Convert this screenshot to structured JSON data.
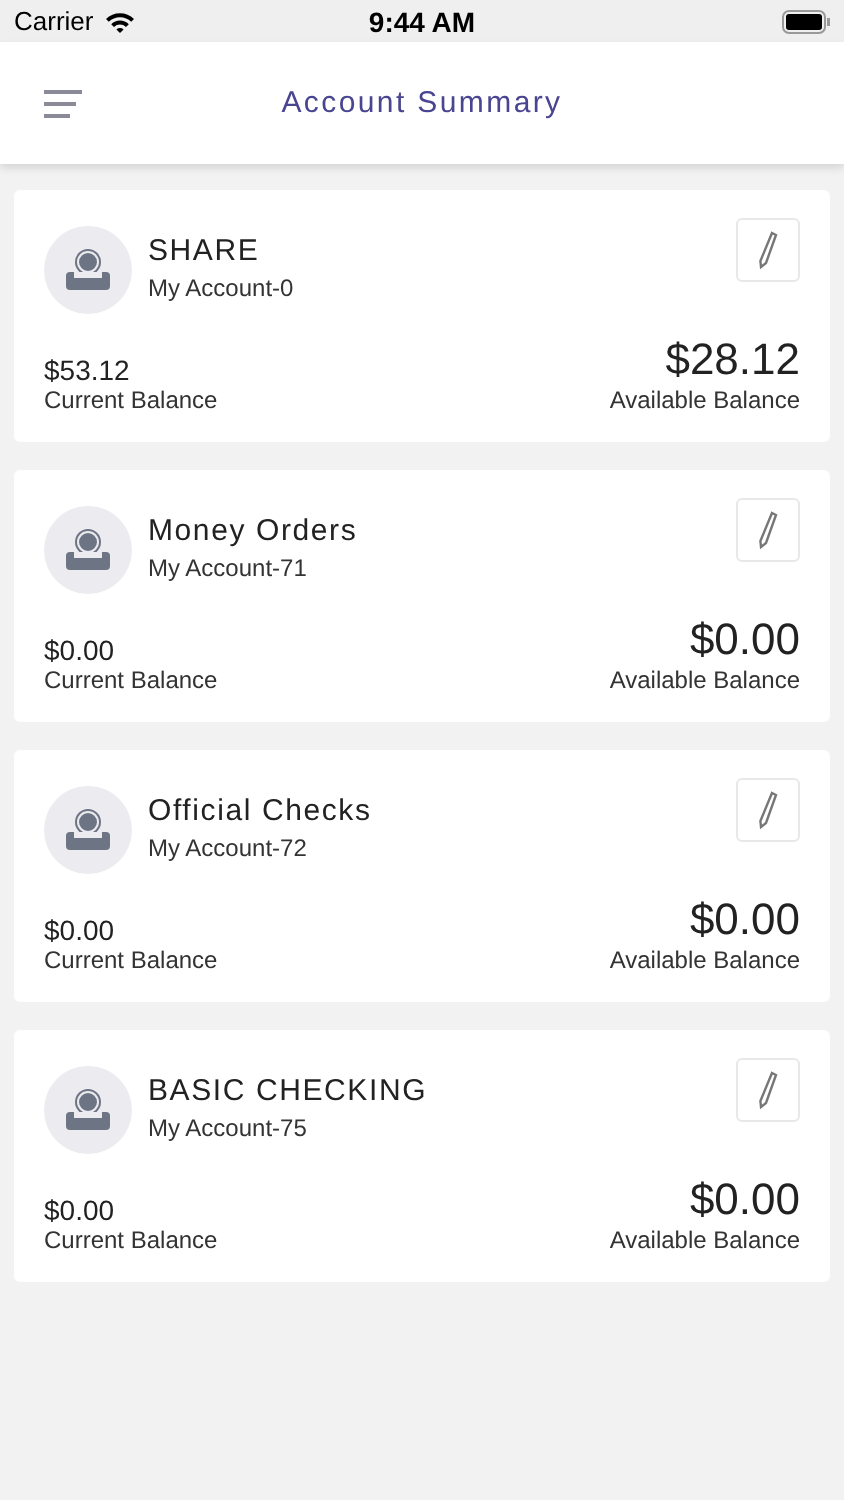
{
  "status_bar": {
    "carrier": "Carrier",
    "time": "9:44 AM"
  },
  "header": {
    "title": "Account Summary"
  },
  "accounts": [
    {
      "name": "SHARE",
      "number": "My Account-0",
      "current_balance": "$53.12",
      "current_label": "Current Balance",
      "available_balance": "$28.12",
      "available_label": "Available Balance"
    },
    {
      "name": "Money Orders",
      "number": "My Account-71",
      "current_balance": "$0.00",
      "current_label": "Current Balance",
      "available_balance": "$0.00",
      "available_label": "Available Balance"
    },
    {
      "name": "Official Checks",
      "number": "My Account-72",
      "current_balance": "$0.00",
      "current_label": "Current Balance",
      "available_balance": "$0.00",
      "available_label": "Available Balance"
    },
    {
      "name": "BASIC CHECKING",
      "number": "My Account-75",
      "current_balance": "$0.00",
      "current_label": "Current Balance",
      "available_balance": "$0.00",
      "available_label": "Available Balance"
    }
  ]
}
